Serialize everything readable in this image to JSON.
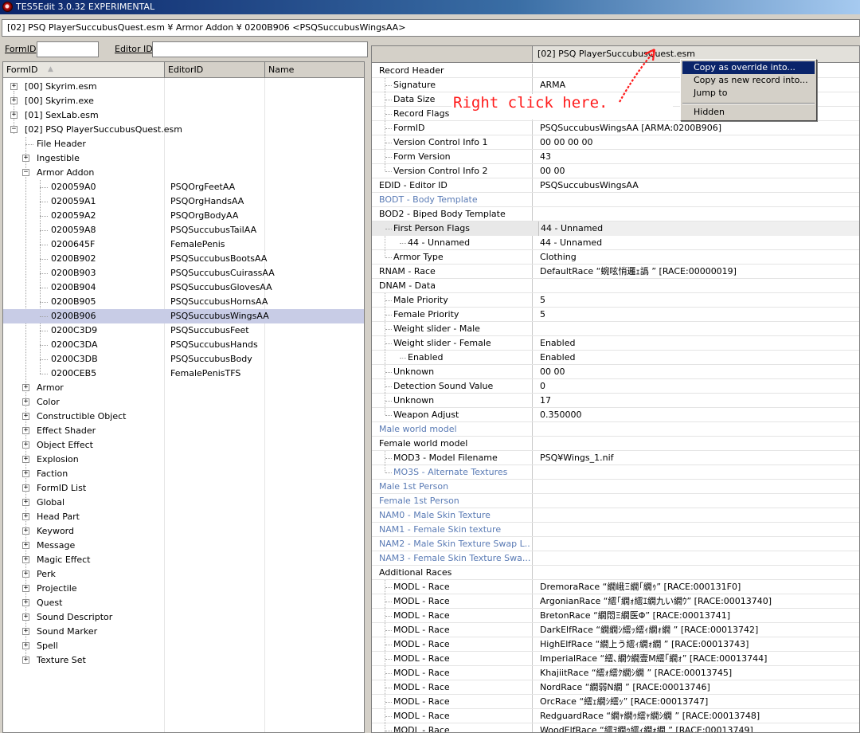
{
  "app": {
    "title": "TES5Edit 3.0.32 EXPERIMENTAL"
  },
  "path_bar": "[02] PSQ PlayerSuccubusQuest.esm ¥ Armor Addon ¥ 0200B906 <PSQSuccubusWingsAA>",
  "filters": {
    "formid_label": "FormID",
    "editorid_label": "Editor ID",
    "formid_value": "",
    "editorid_value": ""
  },
  "left_columns": [
    "FormID",
    "EditorID",
    "Name"
  ],
  "tree": [
    {
      "label": "[00] Skyrim.esm",
      "editor": "",
      "level": 0,
      "exp": "+"
    },
    {
      "label": "[00] Skyrim.exe",
      "editor": "",
      "level": 0,
      "exp": "+"
    },
    {
      "label": "[01] SexLab.esm",
      "editor": "",
      "level": 0,
      "exp": "+"
    },
    {
      "label": "[02] PSQ PlayerSuccubusQuest.esm",
      "editor": "",
      "level": 0,
      "exp": "-"
    },
    {
      "label": "File Header",
      "editor": "",
      "level": 1,
      "exp": ""
    },
    {
      "label": "Ingestible",
      "editor": "",
      "level": 1,
      "exp": "+"
    },
    {
      "label": "Armor Addon",
      "editor": "",
      "level": 1,
      "exp": "-"
    },
    {
      "label": "020059A0",
      "editor": "PSQOrgFeetAA",
      "level": 2,
      "exp": ""
    },
    {
      "label": "020059A1",
      "editor": "PSQOrgHandsAA",
      "level": 2,
      "exp": ""
    },
    {
      "label": "020059A2",
      "editor": "PSQOrgBodyAA",
      "level": 2,
      "exp": ""
    },
    {
      "label": "020059A8",
      "editor": "PSQSuccubusTailAA",
      "level": 2,
      "exp": ""
    },
    {
      "label": "0200645F",
      "editor": "FemalePenis",
      "level": 2,
      "exp": ""
    },
    {
      "label": "0200B902",
      "editor": "PSQSuccubusBootsAA",
      "level": 2,
      "exp": ""
    },
    {
      "label": "0200B903",
      "editor": "PSQSuccubusCuirassAA",
      "level": 2,
      "exp": ""
    },
    {
      "label": "0200B904",
      "editor": "PSQSuccubusGlovesAA",
      "level": 2,
      "exp": ""
    },
    {
      "label": "0200B905",
      "editor": "PSQSuccubusHornsAA",
      "level": 2,
      "exp": ""
    },
    {
      "label": "0200B906",
      "editor": "PSQSuccubusWingsAA",
      "level": 2,
      "exp": "",
      "selected": true
    },
    {
      "label": "0200C3D9",
      "editor": "PSQSuccubusFeet",
      "level": 2,
      "exp": ""
    },
    {
      "label": "0200C3DA",
      "editor": "PSQSuccubusHands",
      "level": 2,
      "exp": ""
    },
    {
      "label": "0200C3DB",
      "editor": "PSQSuccubusBody",
      "level": 2,
      "exp": ""
    },
    {
      "label": "0200CEB5",
      "editor": "FemalePenisTFS",
      "level": 2,
      "exp": ""
    },
    {
      "label": "Armor",
      "editor": "",
      "level": 1,
      "exp": "+"
    },
    {
      "label": "Color",
      "editor": "",
      "level": 1,
      "exp": "+"
    },
    {
      "label": "Constructible Object",
      "editor": "",
      "level": 1,
      "exp": "+"
    },
    {
      "label": "Effect Shader",
      "editor": "",
      "level": 1,
      "exp": "+"
    },
    {
      "label": "Object Effect",
      "editor": "",
      "level": 1,
      "exp": "+"
    },
    {
      "label": "Explosion",
      "editor": "",
      "level": 1,
      "exp": "+"
    },
    {
      "label": "Faction",
      "editor": "",
      "level": 1,
      "exp": "+"
    },
    {
      "label": "FormID List",
      "editor": "",
      "level": 1,
      "exp": "+"
    },
    {
      "label": "Global",
      "editor": "",
      "level": 1,
      "exp": "+"
    },
    {
      "label": "Head Part",
      "editor": "",
      "level": 1,
      "exp": "+"
    },
    {
      "label": "Keyword",
      "editor": "",
      "level": 1,
      "exp": "+"
    },
    {
      "label": "Message",
      "editor": "",
      "level": 1,
      "exp": "+"
    },
    {
      "label": "Magic Effect",
      "editor": "",
      "level": 1,
      "exp": "+"
    },
    {
      "label": "Perk",
      "editor": "",
      "level": 1,
      "exp": "+"
    },
    {
      "label": "Projectile",
      "editor": "",
      "level": 1,
      "exp": "+"
    },
    {
      "label": "Quest",
      "editor": "",
      "level": 1,
      "exp": "+"
    },
    {
      "label": "Sound Descriptor",
      "editor": "",
      "level": 1,
      "exp": "+"
    },
    {
      "label": "Sound Marker",
      "editor": "",
      "level": 1,
      "exp": "+"
    },
    {
      "label": "Spell",
      "editor": "",
      "level": 1,
      "exp": "+"
    },
    {
      "label": "Texture Set",
      "editor": "",
      "level": 1,
      "exp": "+"
    }
  ],
  "right_header": "[02] PSQ PlayerSuccubusQuest.esm",
  "records": [
    {
      "label": "Record Header",
      "value": "",
      "level": 0
    },
    {
      "label": "Signature",
      "value": "ARMA",
      "level": 1
    },
    {
      "label": "Data Size",
      "value": "",
      "level": 1
    },
    {
      "label": "Record Flags",
      "value": "",
      "level": 1
    },
    {
      "label": "FormID",
      "value": "PSQSuccubusWingsAA [ARMA:0200B906]",
      "level": 1
    },
    {
      "label": "Version Control Info 1",
      "value": "00 00 00 00",
      "level": 1
    },
    {
      "label": "Form Version",
      "value": "43",
      "level": 1
    },
    {
      "label": "Version Control Info 2",
      "value": "00 00",
      "level": 1
    },
    {
      "label": "EDID - Editor ID",
      "value": "PSQSuccubusWingsAA",
      "level": 0
    },
    {
      "label": "BODT - Body Template",
      "value": "",
      "level": 0,
      "blue": true
    },
    {
      "label": "BOD2 - Biped Body Template",
      "value": "",
      "level": 0
    },
    {
      "label": "First Person Flags",
      "value": "44 - Unnamed",
      "level": 1,
      "sel": true
    },
    {
      "label": "44 - Unnamed",
      "value": "44 - Unnamed",
      "level": 2
    },
    {
      "label": "Armor Type",
      "value": "Clothing",
      "level": 1
    },
    {
      "label": "RNAM - Race",
      "value": "DefaultRace “蜿呟悄邏ｪ譌 ” [RACE:00000019]",
      "level": 0
    },
    {
      "label": "DNAM - Data",
      "value": "",
      "level": 0
    },
    {
      "label": "Male Priority",
      "value": "5",
      "level": 1
    },
    {
      "label": "Female Priority",
      "value": "5",
      "level": 1
    },
    {
      "label": "Weight slider - Male",
      "value": "",
      "level": 1
    },
    {
      "label": "Weight slider - Female",
      "value": "Enabled",
      "level": 1
    },
    {
      "label": "Enabled",
      "value": "Enabled",
      "level": 2
    },
    {
      "label": "Unknown",
      "value": "00 00",
      "level": 1
    },
    {
      "label": "Detection Sound Value",
      "value": "0",
      "level": 1
    },
    {
      "label": "Unknown",
      "value": "17",
      "level": 1
    },
    {
      "label": "Weapon Adjust",
      "value": "0.350000",
      "level": 1
    },
    {
      "label": "Male world model",
      "value": "",
      "level": 0,
      "blue": true
    },
    {
      "label": "Female world model",
      "value": "",
      "level": 0
    },
    {
      "label": "MOD3 - Model Filename",
      "value": "PSQ¥Wings_1.nif",
      "level": 1
    },
    {
      "label": "MO3S - Alternate Textures",
      "value": "",
      "level": 1,
      "blue": true
    },
    {
      "label": "Male 1st Person",
      "value": "",
      "level": 0,
      "blue": true
    },
    {
      "label": "Female 1st Person",
      "value": "",
      "level": 0,
      "blue": true
    },
    {
      "label": "NAM0 - Male Skin Texture",
      "value": "",
      "level": 0,
      "blue": true
    },
    {
      "label": "NAM1 - Female Skin texture",
      "value": "",
      "level": 0,
      "blue": true
    },
    {
      "label": "NAM2 - Male Skin Texture Swap L...",
      "value": "",
      "level": 0,
      "blue": true
    },
    {
      "label": "NAM3 - Female Skin Texture Swa...",
      "value": "",
      "level": 0,
      "blue": true
    },
    {
      "label": "Additional Races",
      "value": "",
      "level": 0
    },
    {
      "label": "MODL - Race",
      "value": "DremoraRace “繝峨Ξ繝｢繝ｩ” [RACE:000131F0]",
      "level": 1
    },
    {
      "label": "MODL - Race",
      "value": "ArgonianRace “繧｢繝ｫ繧ｴ繝九い繝ｳ” [RACE:00013740]",
      "level": 1
    },
    {
      "label": "MODL - Race",
      "value": "BretonRace “繝悶Ξ繝医Φ” [RACE:00013741]",
      "level": 1
    },
    {
      "label": "MODL - Race",
      "value": "DarkElfRace “繝繝ｼ繧ｯ繧ｨ繝ｫ繝 ” [RACE:00013742]",
      "level": 1
    },
    {
      "label": "MODL - Race",
      "value": "HighElfRace “繝上う繧ｨ繝ｫ繝 ” [RACE:00013743]",
      "level": 1
    },
    {
      "label": "MODL - Race",
      "value": "ImperialRace “繧､繝ｳ繝壹Μ繧｢繝ｫ” [RACE:00013744]",
      "level": 1
    },
    {
      "label": "MODL - Race",
      "value": "KhajiitRace “繧ｫ繧ｸ繝ｼ繝 ” [RACE:00013745]",
      "level": 1
    },
    {
      "label": "MODL - Race",
      "value": "NordRace “繝弱Ν繝 ” [RACE:00013746]",
      "level": 1
    },
    {
      "label": "MODL - Race",
      "value": "OrcRace “繧ｪ繝ｼ繧ｯ” [RACE:00013747]",
      "level": 1
    },
    {
      "label": "MODL - Race",
      "value": "RedguardRace “繝ｬ繝ｩ繧ｬ繝ｼ繝 ” [RACE:00013748]",
      "level": 1
    },
    {
      "label": "MODL - Race",
      "value": "WoodElfRace “繧ｦ繝ｩ繧ｨ繝ｫ繝 ” [RACE:00013749]",
      "level": 1
    }
  ],
  "annotation": "Right click here.",
  "context_menu": [
    "Copy as override into...",
    "Copy as new record into...",
    "Jump to",
    "Hidden"
  ],
  "colors": {
    "annotation": "#ff1a1a",
    "menu_highlight": "#0a246a",
    "disabled_label": "#5a7bb5",
    "selection": "#c8cce6"
  }
}
